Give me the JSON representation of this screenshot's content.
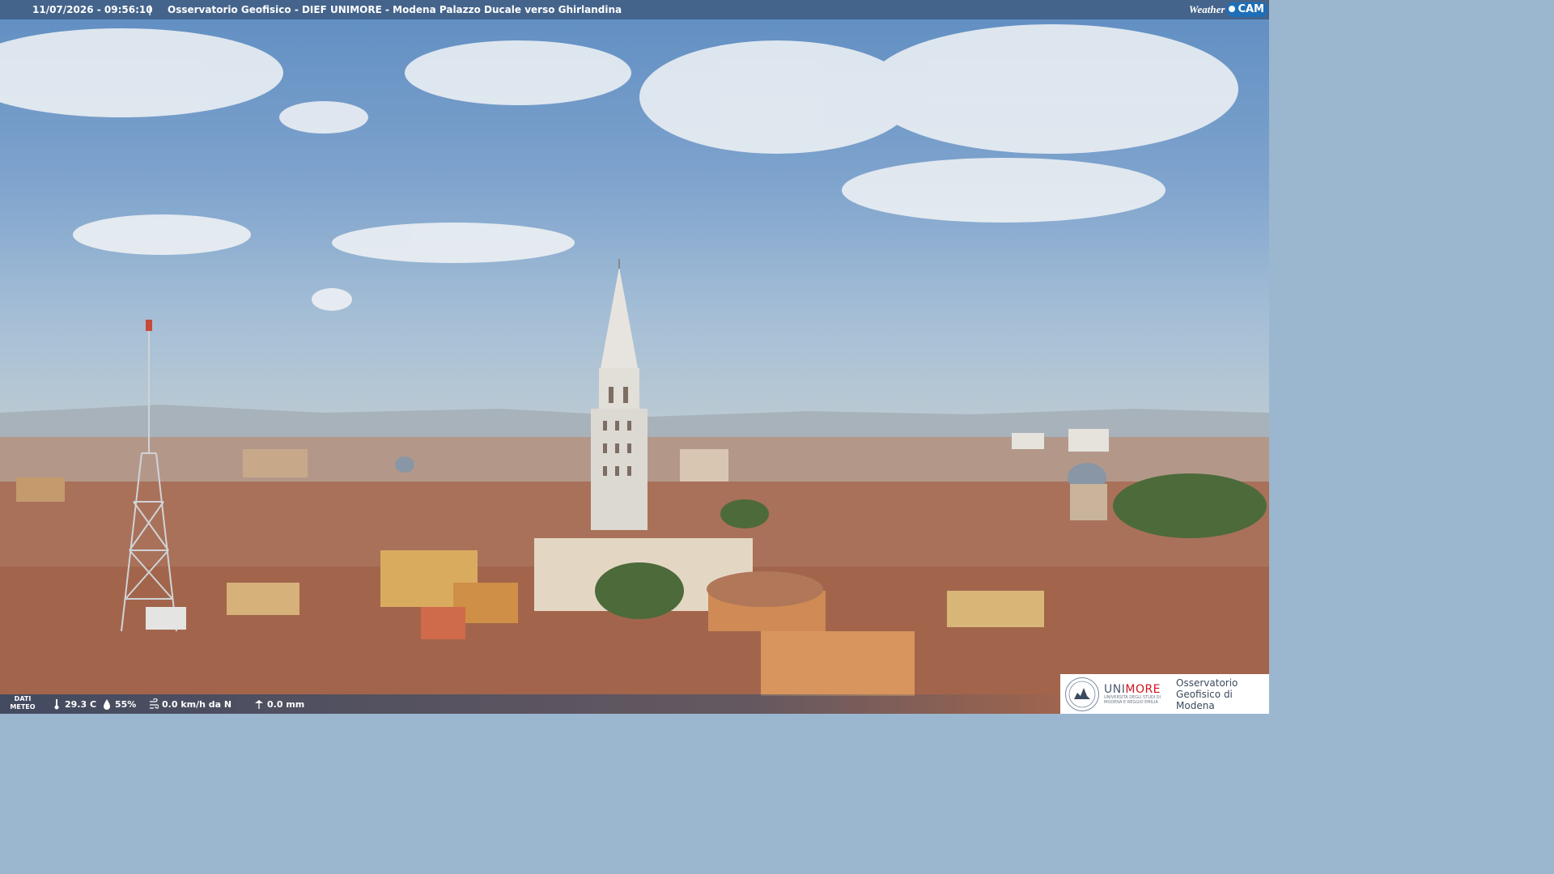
{
  "header": {
    "datetime": "11/07/2026 - 09:56:10",
    "separator": "|",
    "camera_title": "Osservatorio Geofisico - DIEF UNIMORE - Modena Palazzo Ducale verso Ghirlandina",
    "brand_weather": "Weather",
    "brand_cam": "CAM"
  },
  "weather": {
    "label": "DATI METEO",
    "temperature": "29.3 C",
    "humidity": "55%",
    "wind": "0.0 km/h da N",
    "rain": "0.0 mm"
  },
  "logo": {
    "unimore_prefix": "UNI",
    "unimore_suffix": "MORE",
    "unimore_sub": "UNIVERSITÀ DEGLI STUDI DI MODENA E REGGIO EMILIA",
    "observatory": "Osservatorio Geofisico di Modena"
  },
  "colors": {
    "topbar": "#3c587c",
    "brand_blue": "#1e6fb7",
    "unimore_red": "#d2141d"
  }
}
